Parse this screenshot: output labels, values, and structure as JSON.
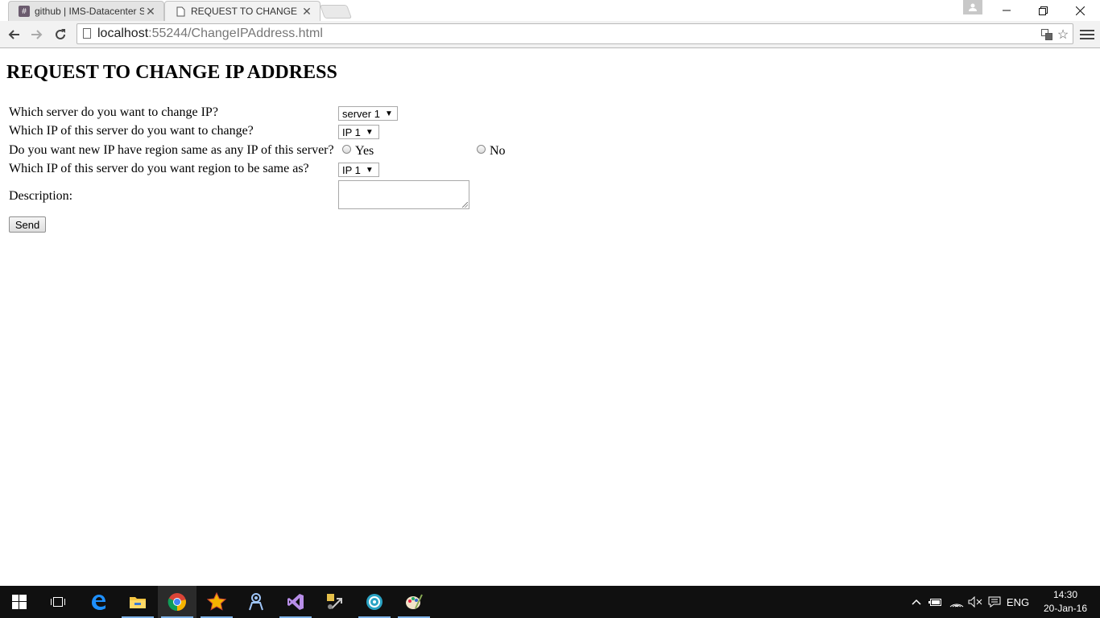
{
  "browser": {
    "tabs": [
      {
        "title": "github | IMS-Datacenter Sl",
        "favicon": "#",
        "active": false
      },
      {
        "title": "REQUEST TO CHANGE IP A",
        "favicon": "page-icon",
        "active": true
      }
    ],
    "url_host": "localhost",
    "url_path": ":55244/ChangeIPAddress.html"
  },
  "page": {
    "heading": "REQUEST TO CHANGE IP ADDRESS",
    "q_server": "Which server do you want to change IP?",
    "server_value": "server 1",
    "q_ip": "Which IP of this server do you want to change?",
    "ip_value": "IP 1",
    "q_region": "Do you want new IP have region same as any IP of this server?",
    "opt_yes": "Yes",
    "opt_no": "No",
    "q_region_ip": "Which IP of this server do you want region to be same as?",
    "region_ip_value": "IP 1",
    "description_label": "Description:",
    "description_value": "",
    "send_label": "Send"
  },
  "taskbar": {
    "apps": [
      "start-icon",
      "task-view-icon",
      "edge-icon",
      "file-explorer-icon",
      "chrome-icon",
      "star-app-icon",
      "robot-app-icon",
      "visual-studio-icon",
      "tools-app-icon",
      "globe-app-icon",
      "paint-app-icon"
    ],
    "lang": "ENG",
    "time": "14:30",
    "date": "20-Jan-16"
  },
  "colors": {
    "taskbar": "#101010",
    "accent": "#7fb3e8",
    "chrome_toolbar": "#f2f2f2"
  }
}
